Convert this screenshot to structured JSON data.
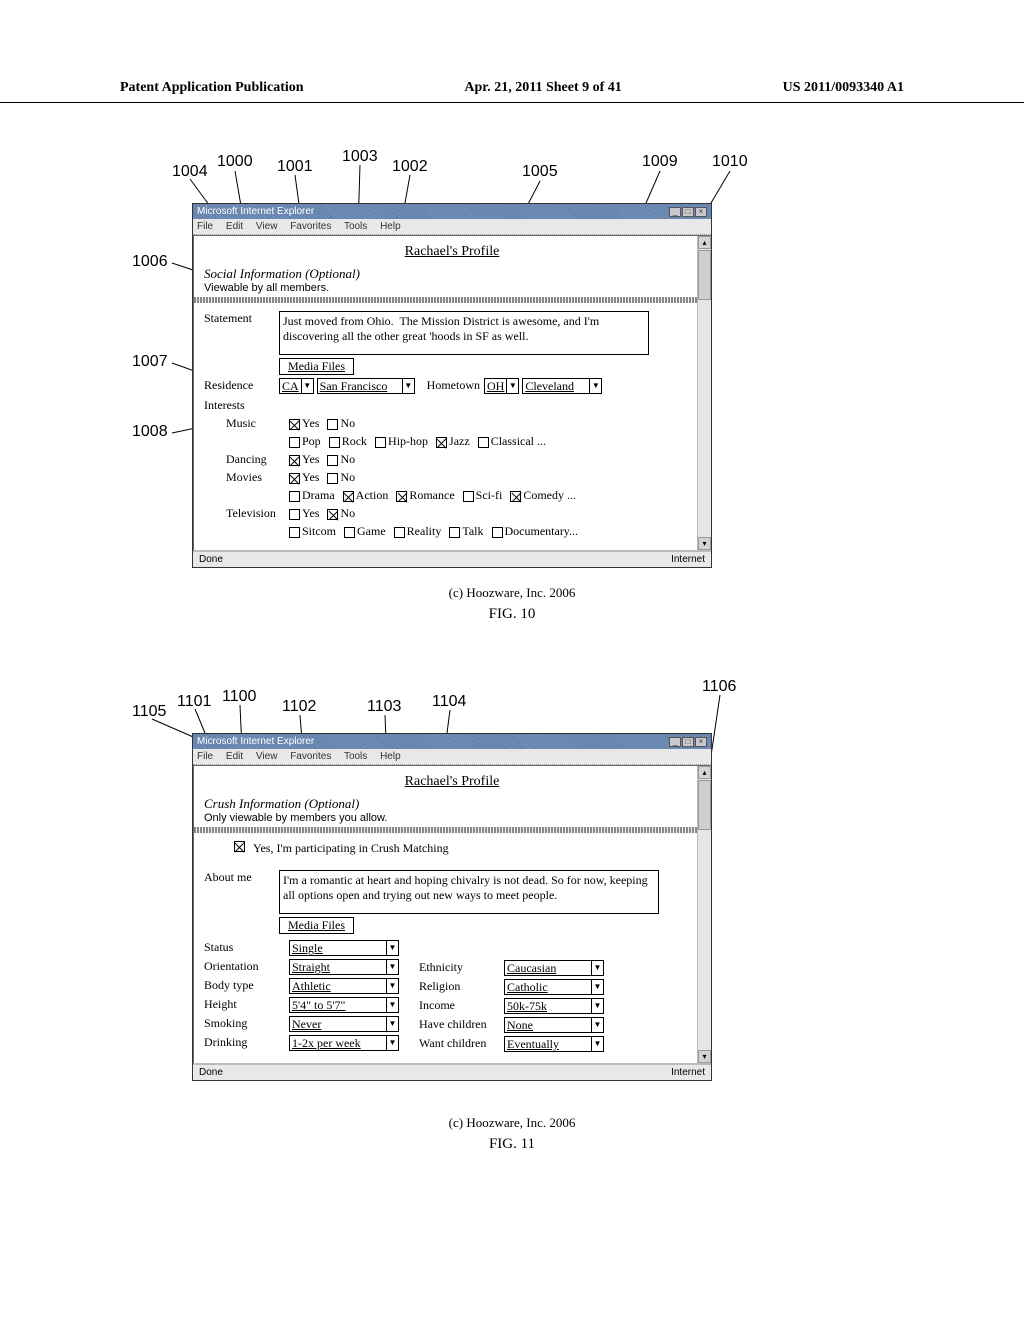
{
  "header": {
    "left": "Patent Application Publication",
    "center": "Apr. 21, 2011  Sheet 9 of 41",
    "right": "US 2011/0093340 A1"
  },
  "browser": {
    "title": "Microsoft Internet Explorer",
    "menus": [
      "File",
      "Edit",
      "View",
      "Favorites",
      "Tools",
      "Help"
    ],
    "status_left": "Done",
    "status_right": "Internet"
  },
  "fig10": {
    "callouts": {
      "c1004": "1004",
      "c1000": "1000",
      "c1001": "1001",
      "c1003": "1003",
      "c1002": "1002",
      "c1005": "1005",
      "c1009": "1009",
      "c1010": "1010",
      "c1006": "1006",
      "c1007": "1007",
      "c1008": "1008"
    },
    "profile_title": "Rachael's Profile",
    "section_head": "Social Information (Optional)",
    "section_sub": "Viewable by all members.",
    "statement_label": "Statement",
    "statement_text": "Just moved from Ohio.  The Mission District is awesome, and I'm discovering all the other great 'hoods in SF as well.",
    "media_btn": "Media Files",
    "residence_label": "Residence",
    "residence_state": "CA",
    "residence_city": "San Francisco",
    "hometown_label": "Hometown",
    "hometown_state": "OH",
    "hometown_city": "Cleveland",
    "interests_label": "Interests",
    "interests": {
      "music": {
        "label": "Music",
        "yes": true,
        "no": false,
        "genres": [
          [
            "Pop",
            false
          ],
          [
            "Rock",
            false
          ],
          [
            "Hip-hop",
            false
          ],
          [
            "Jazz",
            true
          ],
          [
            "Classical ...",
            false
          ]
        ]
      },
      "dancing": {
        "label": "Dancing",
        "yes": true,
        "no": false
      },
      "movies": {
        "label": "Movies",
        "yes": true,
        "no": false,
        "genres": [
          [
            "Drama",
            false
          ],
          [
            "Action",
            true
          ],
          [
            "Romance",
            true
          ],
          [
            "Sci-fi",
            false
          ],
          [
            "Comedy ...",
            true
          ]
        ]
      },
      "tv": {
        "label": "Television",
        "yes": false,
        "no": true,
        "genres": [
          [
            "Sitcom",
            false
          ],
          [
            "Game",
            false
          ],
          [
            "Reality",
            false
          ],
          [
            "Talk",
            false
          ],
          [
            "Documentary...",
            false
          ]
        ]
      }
    },
    "copyright": "(c) Hoozware, Inc. 2006",
    "fig_label": "FIG. 10"
  },
  "fig11": {
    "callouts": {
      "c1105": "1105",
      "c1101": "1101",
      "c1100": "1100",
      "c1102": "1102",
      "c1103": "1103",
      "c1104": "1104",
      "c1106": "1106"
    },
    "profile_title": "Rachael's Profile",
    "section_head": "Crush Information (Optional)",
    "section_sub": "Only viewable by members you allow.",
    "participate_checked": true,
    "participate_label": "Yes, I'm participating in Crush Matching",
    "about_label": "About me",
    "about_text": "I'm a romantic at heart and hoping chivalry is not dead. So for now, keeping all options open and trying out new ways to meet people.",
    "media_btn": "Media Files",
    "left_fields": [
      [
        "Status",
        "Single"
      ],
      [
        "Orientation",
        "Straight"
      ],
      [
        "Body type",
        "Athletic"
      ],
      [
        "Height",
        "5'4\" to 5'7\""
      ],
      [
        "Smoking",
        "Never"
      ],
      [
        "Drinking",
        "1-2x per week"
      ]
    ],
    "right_fields": [
      [
        "Ethnicity",
        "Caucasian"
      ],
      [
        "Religion",
        "Catholic"
      ],
      [
        "Income",
        "50k-75k"
      ],
      [
        "Have children",
        "None"
      ],
      [
        "Want children",
        "Eventually"
      ]
    ],
    "copyright": "(c) Hoozware, Inc. 2006",
    "fig_label": "FIG. 11"
  }
}
